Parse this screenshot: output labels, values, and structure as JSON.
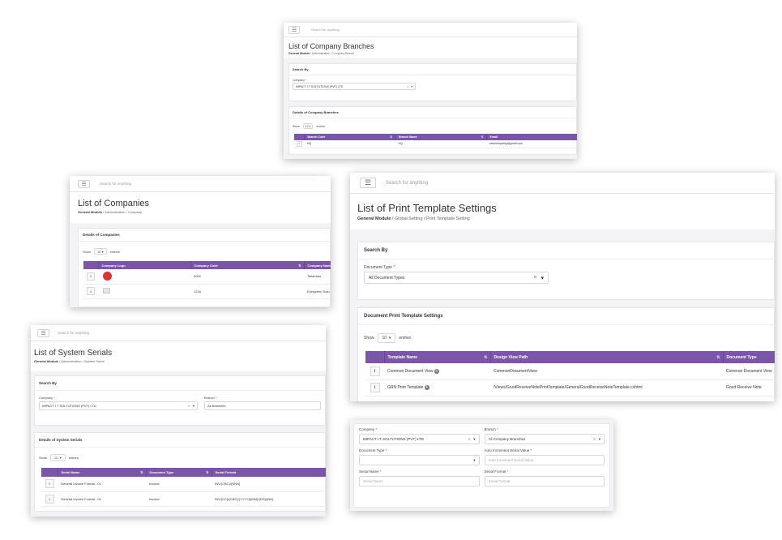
{
  "search_placeholder": "Search for anything",
  "branches": {
    "title": "List of Company Branches",
    "bc": [
      "General Module",
      "Administration",
      "Company Branch"
    ],
    "search_by": "Search By",
    "company_label": "Company",
    "company_value": "IMPACT I T SOLTUTIONS (PVT) LTD",
    "details": "Details of Company Branches",
    "show": "Show",
    "page_size": "10",
    "entries": "entries",
    "columns": [
      "Branch Code",
      "Branch Name",
      "Email"
    ],
    "rows": [
      [
        "HQ",
        "HQ",
        "www.itmparity@gmail.com"
      ]
    ]
  },
  "companies": {
    "title": "List of Companies",
    "bc": [
      "General Module",
      "Administration",
      "Company"
    ],
    "details": "Details of Companies",
    "show": "Show",
    "page_size": "10",
    "entries": "entries",
    "columns": [
      "Company Logo",
      "Company Code",
      "Company Name"
    ],
    "rows": [
      [
        "",
        "0002",
        "Tstlamber"
      ],
      [
        "",
        "1234",
        "Evergreen Solu"
      ]
    ]
  },
  "print": {
    "title": "List of Print Template Settings",
    "bc": [
      "General Module",
      "Global Setting",
      "Print Template Setting"
    ],
    "search_by": "Search By",
    "doctype_label": "Document Type",
    "doctype_value": "All Document Types",
    "details": "Document Print Template Settings",
    "show": "Show",
    "page_size": "10",
    "entries": "entries",
    "columns": [
      "Template Name",
      "Design View Path",
      "Document Type"
    ],
    "rows": [
      [
        "Common Document View",
        "CommonDocumentView",
        "Common Document View"
      ],
      [
        "GRN Print Template",
        "/Views/GoodReceiveNotePrintTemplate/GeneralGoodReceiveNoteTemplate.cshtml",
        "Good Receive Note"
      ]
    ]
  },
  "serials": {
    "title": "List of System Serials",
    "bc": [
      "General Module",
      "Administration",
      "System Serial"
    ],
    "search_by": "Search By",
    "company_label": "Company",
    "company_value": "IMPACT I T SOLTUTIONS (PVT) LTD",
    "branch_label": "Branch",
    "branch_value": "All Branches",
    "details": "Details of System Serials",
    "show": "Show",
    "page_size": "10",
    "entries": "entries",
    "columns": [
      "Serial Name",
      "Document Type",
      "Serial Format"
    ],
    "rows": [
      [
        "General Invoice Format - 01",
        "Invoice",
        "INV/{CBC}/{NNN}"
      ],
      [
        "General Invoice Format - 01",
        "Invoice",
        "INV/{CC}/{CBC}/{YYYY}/{MM}/{DD}/{NN}"
      ]
    ]
  },
  "form": {
    "company_label": "Company",
    "company_value": "IMPACT I T SOLTUTIONS (PVT) LTD",
    "branch_label": "Branch",
    "branch_value": "All Company Branches",
    "doctype_label": "Document Type",
    "doctype_value": "",
    "auto_label": "Auto Increment Serial Value",
    "auto_placeholder": "Auto Increment Serial Value",
    "sname_label": "Serial Name",
    "sname_placeholder": "Serial Name",
    "sformat_label": "Serial Format",
    "sformat_placeholder": "Serial Format"
  },
  "icons": {
    "clear": "×",
    "caret": "▾",
    "menu": "☰",
    "sort": "⇅",
    "info": "i",
    "add": "+"
  },
  "colors": {
    "table_header": "#7b56a8",
    "required": "#d9363e"
  }
}
